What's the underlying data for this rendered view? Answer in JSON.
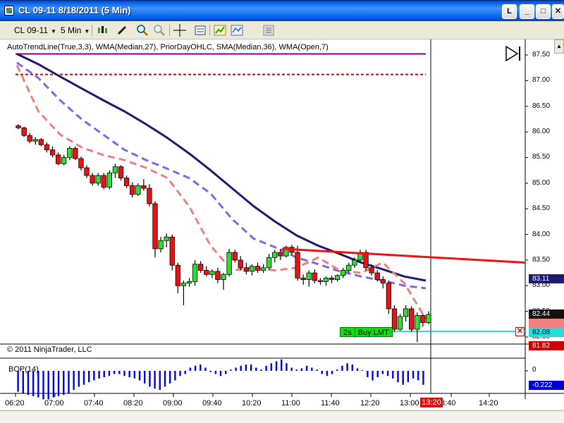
{
  "window": {
    "title": "CL 09-11  8/18/2011 (5 Min)",
    "buttons": {
      "l": "L",
      "minimize": "_",
      "maximize": "□",
      "close": "✕"
    }
  },
  "toolbar": {
    "instrument": "CL 09-11",
    "interval": "5 Min",
    "icons": [
      "candlestick-chart-icon",
      "drawing-pen-icon",
      "zoom-in-icon",
      "zoom-out-icon",
      "crosshair-icon",
      "data-box-icon",
      "indicators-icon",
      "strategies-icon",
      "properties-icon"
    ]
  },
  "chart": {
    "indicator_header": "AutoTrendLine(True,3,3), WMA(Median,27), PriorDayOHLC, SMA(Median,36), WMA(Open,7)",
    "copyright": "© 2011 NinjaTrader, LLC",
    "bop_label": "BOP(14)",
    "price_labels": [
      "87.50",
      "87.00",
      "86.50",
      "86.00",
      "85.50",
      "85.00",
      "84.50",
      "84.00",
      "83.50",
      "83.00",
      "82.50",
      "82.00"
    ],
    "tags": {
      "sma": "83.11",
      "last": "82.44",
      "buy_limit": "82.08",
      "prior_low": "81.82",
      "bop_value": "-0.222"
    },
    "bop_zero": "0",
    "order": {
      "size": "2s",
      "label": "Buy LMT"
    },
    "cancel_icon": "✕",
    "time_labels": [
      "06:20",
      "07:00",
      "07:40",
      "08:20",
      "09:00",
      "09:40",
      "10:20",
      "11:00",
      "11:40",
      "12:20",
      "13:00",
      "3:40",
      "14:20"
    ],
    "current_time": "13:20",
    "colors": {
      "up_candle": "#33dd33",
      "down_candle": "#ee1111",
      "wma27": "#1a1a6e",
      "sma36": "#7b68ee",
      "wma7": "#f08080",
      "trendline": "#ee1111",
      "prior_high": "#800080",
      "prior_close": "#cc0000",
      "bop": "#0000dd",
      "limit_line": "#00cccc"
    }
  },
  "chart_data": {
    "type": "candlestick",
    "instrument": "CL 09-11",
    "interval": "5 Min",
    "date": "8/18/2011",
    "x_ticks": [
      "06:20",
      "07:00",
      "07:40",
      "08:20",
      "09:00",
      "09:40",
      "10:20",
      "11:00",
      "11:40",
      "12:20",
      "13:00",
      "13:20",
      "3:40",
      "14:20"
    ],
    "y_ticks": [
      87.5,
      87.0,
      86.5,
      86.0,
      85.5,
      85.0,
      84.5,
      84.0,
      83.5,
      83.0,
      82.5,
      82.0
    ],
    "ylim": [
      81.7,
      87.7
    ],
    "candles": [
      {
        "o": 86.12,
        "h": 86.15,
        "l": 86.05,
        "c": 86.08
      },
      {
        "o": 86.08,
        "h": 86.1,
        "l": 85.9,
        "c": 85.93
      },
      {
        "o": 85.93,
        "h": 85.98,
        "l": 85.78,
        "c": 85.82
      },
      {
        "o": 85.82,
        "h": 85.9,
        "l": 85.75,
        "c": 85.85
      },
      {
        "o": 85.85,
        "h": 85.88,
        "l": 85.72,
        "c": 85.75
      },
      {
        "o": 85.75,
        "h": 85.8,
        "l": 85.6,
        "c": 85.65
      },
      {
        "o": 85.65,
        "h": 85.72,
        "l": 85.5,
        "c": 85.55
      },
      {
        "o": 85.55,
        "h": 85.6,
        "l": 85.35,
        "c": 85.38
      },
      {
        "o": 85.38,
        "h": 85.55,
        "l": 85.35,
        "c": 85.5
      },
      {
        "o": 85.5,
        "h": 85.72,
        "l": 85.45,
        "c": 85.68
      },
      {
        "o": 85.68,
        "h": 85.72,
        "l": 85.45,
        "c": 85.48
      },
      {
        "o": 85.48,
        "h": 85.52,
        "l": 85.25,
        "c": 85.3
      },
      {
        "o": 85.3,
        "h": 85.35,
        "l": 85.1,
        "c": 85.15
      },
      {
        "o": 85.15,
        "h": 85.2,
        "l": 84.95,
        "c": 85.0
      },
      {
        "o": 85.0,
        "h": 85.2,
        "l": 84.95,
        "c": 85.15
      },
      {
        "o": 85.15,
        "h": 85.2,
        "l": 84.88,
        "c": 84.92
      },
      {
        "o": 84.92,
        "h": 85.25,
        "l": 84.88,
        "c": 85.2
      },
      {
        "o": 85.2,
        "h": 85.38,
        "l": 85.1,
        "c": 85.32
      },
      {
        "o": 85.32,
        "h": 85.35,
        "l": 85.05,
        "c": 85.1
      },
      {
        "o": 85.1,
        "h": 85.15,
        "l": 84.9,
        "c": 84.95
      },
      {
        "o": 84.95,
        "h": 85.02,
        "l": 84.72,
        "c": 84.78
      },
      {
        "o": 84.78,
        "h": 85.0,
        "l": 84.75,
        "c": 84.95
      },
      {
        "o": 84.95,
        "h": 85.08,
        "l": 84.85,
        "c": 84.9
      },
      {
        "o": 84.9,
        "h": 84.98,
        "l": 84.55,
        "c": 84.6
      },
      {
        "o": 84.6,
        "h": 84.65,
        "l": 83.55,
        "c": 83.72
      },
      {
        "o": 83.72,
        "h": 83.95,
        "l": 83.65,
        "c": 83.88
      },
      {
        "o": 83.88,
        "h": 84.02,
        "l": 83.75,
        "c": 83.95
      },
      {
        "o": 83.95,
        "h": 84.0,
        "l": 83.3,
        "c": 83.4
      },
      {
        "o": 83.4,
        "h": 83.45,
        "l": 82.85,
        "c": 83.0
      },
      {
        "o": 83.0,
        "h": 83.1,
        "l": 82.62,
        "c": 83.05
      },
      {
        "o": 83.05,
        "h": 83.15,
        "l": 82.98,
        "c": 83.08
      },
      {
        "o": 83.08,
        "h": 83.5,
        "l": 83.0,
        "c": 83.42
      },
      {
        "o": 83.42,
        "h": 83.48,
        "l": 83.25,
        "c": 83.3
      },
      {
        "o": 83.3,
        "h": 83.38,
        "l": 83.18,
        "c": 83.22
      },
      {
        "o": 83.22,
        "h": 83.32,
        "l": 83.15,
        "c": 83.28
      },
      {
        "o": 83.28,
        "h": 83.35,
        "l": 83.05,
        "c": 83.12
      },
      {
        "o": 83.12,
        "h": 83.25,
        "l": 82.92,
        "c": 83.22
      },
      {
        "o": 83.22,
        "h": 83.72,
        "l": 83.18,
        "c": 83.65
      },
      {
        "o": 83.65,
        "h": 83.7,
        "l": 83.45,
        "c": 83.5
      },
      {
        "o": 83.5,
        "h": 83.58,
        "l": 83.3,
        "c": 83.35
      },
      {
        "o": 83.35,
        "h": 83.45,
        "l": 83.22,
        "c": 83.28
      },
      {
        "o": 83.28,
        "h": 83.42,
        "l": 83.2,
        "c": 83.38
      },
      {
        "o": 83.38,
        "h": 83.45,
        "l": 83.25,
        "c": 83.3
      },
      {
        "o": 83.3,
        "h": 83.42,
        "l": 83.25,
        "c": 83.35
      },
      {
        "o": 83.35,
        "h": 83.62,
        "l": 83.3,
        "c": 83.55
      },
      {
        "o": 83.55,
        "h": 83.7,
        "l": 83.45,
        "c": 83.65
      },
      {
        "o": 83.65,
        "h": 83.72,
        "l": 83.5,
        "c": 83.58
      },
      {
        "o": 83.58,
        "h": 83.78,
        "l": 83.55,
        "c": 83.75
      },
      {
        "o": 83.75,
        "h": 83.8,
        "l": 83.6,
        "c": 83.65
      },
      {
        "o": 83.65,
        "h": 83.78,
        "l": 83.1,
        "c": 83.15
      },
      {
        "o": 83.15,
        "h": 83.22,
        "l": 83.02,
        "c": 83.12
      },
      {
        "o": 83.12,
        "h": 83.3,
        "l": 82.98,
        "c": 83.25
      },
      {
        "o": 83.25,
        "h": 83.32,
        "l": 83.05,
        "c": 83.1
      },
      {
        "o": 83.1,
        "h": 83.15,
        "l": 83.02,
        "c": 83.08
      },
      {
        "o": 83.08,
        "h": 83.18,
        "l": 83.0,
        "c": 83.15
      },
      {
        "o": 83.15,
        "h": 83.2,
        "l": 83.05,
        "c": 83.12
      },
      {
        "o": 83.12,
        "h": 83.22,
        "l": 83.08,
        "c": 83.2
      },
      {
        "o": 83.2,
        "h": 83.35,
        "l": 83.15,
        "c": 83.3
      },
      {
        "o": 83.3,
        "h": 83.45,
        "l": 83.25,
        "c": 83.4
      },
      {
        "o": 83.4,
        "h": 83.55,
        "l": 83.35,
        "c": 83.5
      },
      {
        "o": 83.5,
        "h": 83.7,
        "l": 83.45,
        "c": 83.65
      },
      {
        "o": 83.65,
        "h": 83.7,
        "l": 83.3,
        "c": 83.35
      },
      {
        "o": 83.35,
        "h": 83.42,
        "l": 83.2,
        "c": 83.25
      },
      {
        "o": 83.25,
        "h": 83.3,
        "l": 83.08,
        "c": 83.12
      },
      {
        "o": 83.12,
        "h": 83.18,
        "l": 82.95,
        "c": 83.05
      },
      {
        "o": 83.05,
        "h": 83.1,
        "l": 82.45,
        "c": 82.55
      },
      {
        "o": 82.55,
        "h": 82.62,
        "l": 82.1,
        "c": 82.15
      },
      {
        "o": 82.15,
        "h": 82.45,
        "l": 82.12,
        "c": 82.4
      },
      {
        "o": 82.4,
        "h": 82.62,
        "l": 82.3,
        "c": 82.55
      },
      {
        "o": 82.55,
        "h": 82.6,
        "l": 82.1,
        "c": 82.15
      },
      {
        "o": 82.15,
        "h": 82.48,
        "l": 81.9,
        "c": 82.42
      },
      {
        "o": 82.42,
        "h": 82.45,
        "l": 82.2,
        "c": 82.28
      },
      {
        "o": 82.28,
        "h": 82.5,
        "l": 82.25,
        "c": 82.44
      }
    ],
    "series": [
      {
        "name": "WMA(Median,27)",
        "values": [
          87.52,
          87.32,
          87.08,
          86.85,
          86.62,
          86.4,
          86.15,
          85.88,
          85.58,
          85.25,
          84.9,
          84.55,
          84.25,
          83.98,
          83.78,
          83.62,
          83.45,
          83.32,
          83.18,
          83.1
        ]
      },
      {
        "name": "SMA(Median,36)",
        "values": [
          87.35,
          87.05,
          86.62,
          86.25,
          85.95,
          85.65,
          85.45,
          85.28,
          85.1,
          84.8,
          84.3,
          83.92,
          83.75,
          83.55,
          83.42,
          83.28,
          83.18,
          83.1,
          83.0,
          82.95
        ]
      },
      {
        "name": "WMA(Open,7)",
        "values": [
          87.3,
          86.4,
          85.95,
          85.7,
          85.55,
          85.45,
          85.3,
          85.1,
          84.55,
          83.78,
          83.3,
          83.35,
          83.3,
          83.35,
          83.55,
          83.3,
          83.25,
          83.45,
          83.05,
          82.35
        ]
      },
      {
        "name": "AutoTrendLine",
        "values": [
          83.72,
          83.45
        ]
      },
      {
        "name": "PriorDayOHLC",
        "values": [
          87.52,
          87.12,
          81.82
        ]
      }
    ],
    "bop": {
      "label": "BOP(14)",
      "current": -0.222,
      "values": [
        -0.33,
        -0.35,
        -0.38,
        -0.4,
        -0.42,
        -0.45,
        -0.45,
        -0.42,
        -0.4,
        -0.38,
        -0.35,
        -0.3,
        -0.25,
        -0.22,
        -0.18,
        -0.15,
        -0.12,
        -0.1,
        -0.08,
        -0.05,
        -0.05,
        -0.08,
        -0.1,
        -0.12,
        -0.15,
        -0.2,
        -0.25,
        -0.28,
        -0.3,
        -0.25,
        -0.2,
        -0.15,
        -0.08,
        -0.05,
        0.05,
        0.08,
        0.1,
        0.05,
        -0.02,
        -0.05,
        -0.08,
        -0.05,
        0.02,
        0.05,
        0.08,
        0.1,
        0.1,
        0.05,
        0.02,
        0.08,
        0.12,
        0.15,
        0.18,
        0.12,
        0.05,
        0.02,
        0.04,
        0.08,
        0.05,
        0.02,
        -0.05,
        -0.08,
        -0.05,
        0.02,
        0.08,
        0.12,
        0.1,
        0.04,
        0.01,
        -0.1,
        -0.15,
        -0.1,
        -0.05,
        -0.08,
        -0.12,
        -0.18,
        -0.22,
        -0.18,
        -0.12,
        -0.15,
        -0.22
      ]
    }
  }
}
